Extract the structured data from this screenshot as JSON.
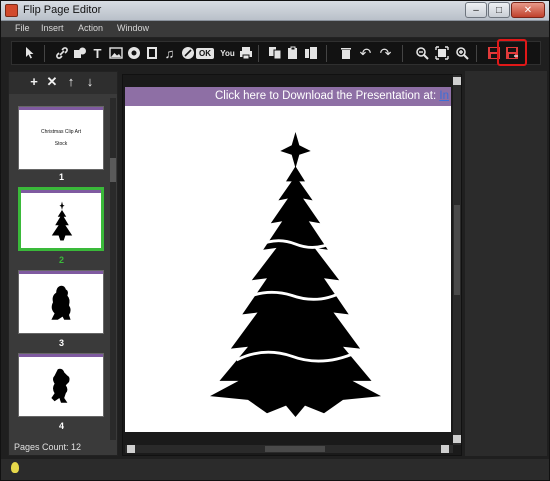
{
  "window": {
    "title": "Flip Page Editor"
  },
  "menu": [
    "File",
    "Insert",
    "Action",
    "Window"
  ],
  "toolbar": {
    "tools": [
      "select-tool",
      "link-tool",
      "shape-tool",
      "text-tool",
      "image-tool",
      "flash-tool",
      "video-tool",
      "audio-tool",
      "youtube-tool",
      "button-tool",
      "print-tool",
      "copy-tool",
      "paste-tool",
      "align-tool",
      "delete-tool",
      "undo-tool",
      "redo-tool",
      "zoom-out-tool",
      "fit-tool",
      "zoom-in-tool",
      "save-tool",
      "save-exit-tool"
    ],
    "button_label": "OK"
  },
  "thumbnails": [
    {
      "number": "1",
      "text": "Christmas Clip Art",
      "subtext": "Stock"
    },
    {
      "number": "2"
    },
    {
      "number": "3"
    },
    {
      "number": "4"
    }
  ],
  "selected_page": "2",
  "pages_count": "Pages Count: 12",
  "page": {
    "banner_text": "Click here to Download the Presentation at: ",
    "banner_link": "In"
  },
  "colors": {
    "accent_selected": "#3ab93a",
    "banner": "#8e6fa5",
    "highlight": "#e01818"
  }
}
